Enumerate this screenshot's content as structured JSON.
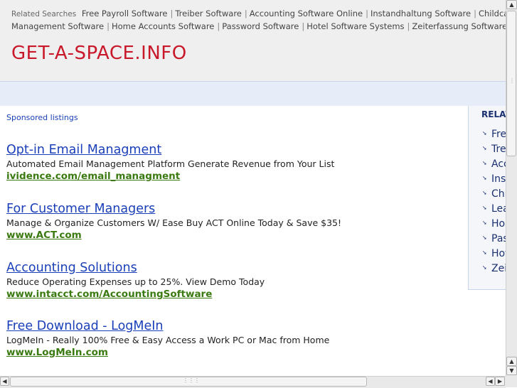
{
  "header": {
    "related_label": "Related Searches",
    "related_links": [
      "Free Payroll Software",
      "Treiber Software",
      "Accounting Software Online",
      "Instandhaltung Software",
      "Childcare Management Software",
      "Home Accounts Software",
      "Password Software",
      "Hotel Software Systems",
      "Zeiterfassung Software"
    ],
    "site_title": "GET-A-SPACE.INFO"
  },
  "main": {
    "sponsored_label": "Sponsored listings",
    "ads": [
      {
        "title": "Opt-in Email Managment",
        "desc": "Automated Email Management Platform Generate Revenue from Your List",
        "url": "ividence.com/email_managment"
      },
      {
        "title": "For Customer Managers",
        "desc": "Manage & Organize Customers W/ Ease Buy ACT Online Today & Save $35!",
        "url": "www.ACT.com"
      },
      {
        "title": "Accounting Solutions",
        "desc": "Reduce Operating Expenses up to 25%. View Demo Today",
        "url": "www.intacct.com/AccountingSoftware"
      },
      {
        "title": "Free Download - LogMeIn",
        "desc": "LogMeIn - Really 100% Free & Easy Access a Work PC or Mac from Home",
        "url": "www.LogMeIn.com"
      }
    ]
  },
  "right_panel": {
    "title": "RELAT",
    "items": [
      "Fre",
      "Tre",
      "Acc",
      "Inst",
      "Chi",
      "Lea",
      "Hon",
      "Pas",
      "Hot",
      "Zei"
    ]
  },
  "scrollbars": {
    "up": "▲",
    "down": "▼",
    "left": "◀",
    "right": "▶"
  }
}
